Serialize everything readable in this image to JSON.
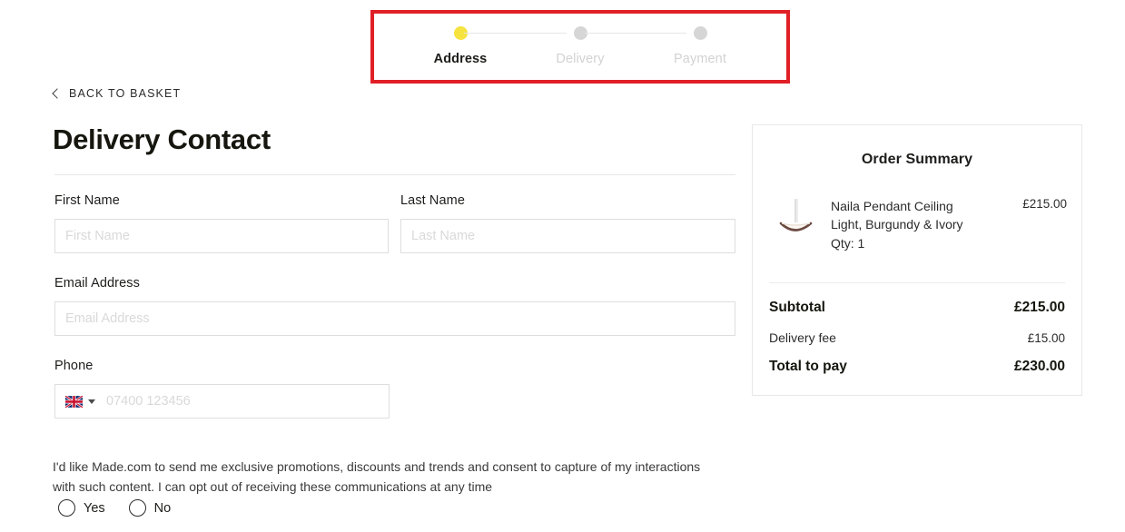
{
  "stepper": {
    "steps": [
      {
        "label": "Address",
        "state": "active"
      },
      {
        "label": "Delivery",
        "state": "inactive"
      },
      {
        "label": "Payment",
        "state": "inactive"
      }
    ],
    "active_color": "#f6e33f",
    "inactive_color": "#d6d6d6"
  },
  "annotation": {
    "color": "#e01f26"
  },
  "back_link": {
    "label": "BACK TO BASKET",
    "icon": "chevron-left-icon"
  },
  "page": {
    "title": "Delivery Contact"
  },
  "form": {
    "first_name": {
      "label": "First Name",
      "placeholder": "First Name",
      "value": ""
    },
    "last_name": {
      "label": "Last Name",
      "placeholder": "Last Name",
      "value": ""
    },
    "email": {
      "label": "Email Address",
      "placeholder": "Email Address",
      "value": ""
    },
    "phone": {
      "label": "Phone",
      "placeholder": "07400 123456",
      "value": "",
      "country_flag": "uk-flag-icon"
    }
  },
  "consent": {
    "text": "I'd like Made.com to send me exclusive promotions, discounts and trends and consent to capture of my interactions with such content. I can opt out of receiving these communications at any time",
    "options": [
      {
        "label": "Yes",
        "selected": false
      },
      {
        "label": "No",
        "selected": false
      }
    ]
  },
  "order_summary": {
    "title": "Order Summary",
    "item": {
      "name": "Naila Pendant Ceiling Light, Burgundy & Ivory",
      "qty_label": "Qty: 1",
      "price": "£215.00",
      "thumbnail": "pendant-light-thumbnail"
    },
    "totals": [
      {
        "label": "Subtotal",
        "value": "£215.00",
        "emphasis": "bold"
      },
      {
        "label": "Delivery fee",
        "value": "£15.00",
        "emphasis": "regular"
      },
      {
        "label": "Total to pay",
        "value": "£230.00",
        "emphasis": "bold"
      }
    ]
  }
}
